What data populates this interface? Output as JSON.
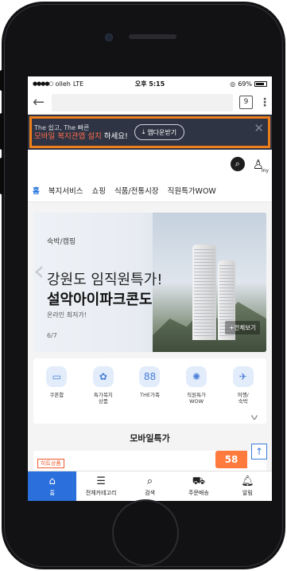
{
  "status": {
    "carrier": "olleh",
    "network": "LTE",
    "time": "오후 5:15",
    "battery": "69%"
  },
  "browser": {
    "tab_count": "9"
  },
  "banner": {
    "line1": "The 쉽고, The 빠른",
    "line2_prefix": "",
    "line2_accent": "모바일 복지관앱 설치",
    "line2_suffix": " 하세요!",
    "download_label": "앱다운받기"
  },
  "header": {
    "my_badge": "my"
  },
  "categories": [
    "홈",
    "복지서비스",
    "쇼핑",
    "식품/전통시장",
    "직원특가WOW"
  ],
  "hero": {
    "tag": "숙박/캠핑",
    "title1": "강원도 임직원특가!",
    "title2": "설악아이파크콘도",
    "subtitle": "온라인 최저가!",
    "page_indicator": "6/7",
    "view_all": "+전체보기"
  },
  "quick_menu": [
    {
      "icon": "coupon-icon",
      "label": "쿠폰함"
    },
    {
      "icon": "special-welfare-icon",
      "label": "특가복지\n상품"
    },
    {
      "icon": "family-icon",
      "label": "THE가족"
    },
    {
      "icon": "wow-icon",
      "label": "직원특가\nWOW"
    },
    {
      "icon": "travel-icon",
      "label": "여행/\n숙박"
    }
  ],
  "section": {
    "title": "모바일특가"
  },
  "promo": {
    "hot_label": "히트상품",
    "badge": "58"
  },
  "bottom_nav": [
    {
      "icon": "home-icon",
      "label": "홈"
    },
    {
      "icon": "menu-icon",
      "label": "전체카테고리"
    },
    {
      "icon": "search-icon",
      "label": "검색"
    },
    {
      "icon": "delivery-icon",
      "label": "주문배송"
    },
    {
      "icon": "bell-icon",
      "label": "알림"
    }
  ],
  "colors": {
    "accent": "#2a6fdb",
    "banner_bg": "#2e3443",
    "highlight": "#ee7f1b"
  }
}
